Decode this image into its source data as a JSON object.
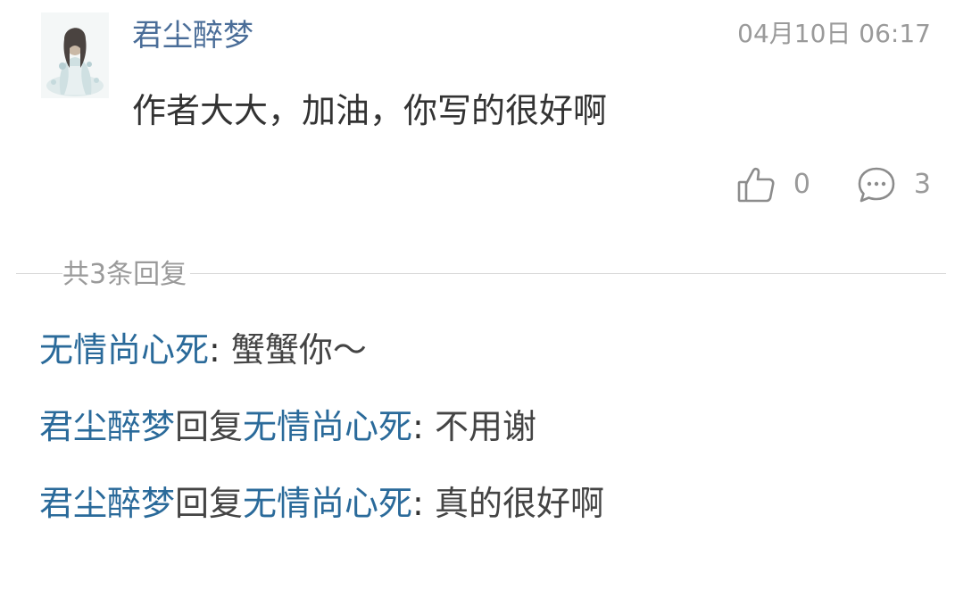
{
  "comment": {
    "author": "君尘醉梦",
    "timestamp": "04月10日 06:17",
    "content": "作者大大，加油，你写的很好啊",
    "like_count": "0",
    "reply_count": "3",
    "like_icon": "thumbs-up-icon",
    "reply_icon": "comment-bubble-icon"
  },
  "replies_header": "共3条回复",
  "replies": [
    {
      "user": "无情尚心死",
      "separator": ":",
      "text": "蟹蟹你～"
    },
    {
      "user": "君尘醉梦",
      "verb": "回复",
      "target": "无情尚心死",
      "separator": ":",
      "text": "不用谢"
    },
    {
      "user": "君尘醉梦",
      "verb": "回复",
      "target": "无情尚心死",
      "separator": ":",
      "text": "真的很好啊"
    }
  ],
  "colors": {
    "author_name": "#4a6d98",
    "reply_username": "#2a6a9a",
    "muted": "#9a9a9a",
    "body_text": "#333333"
  }
}
